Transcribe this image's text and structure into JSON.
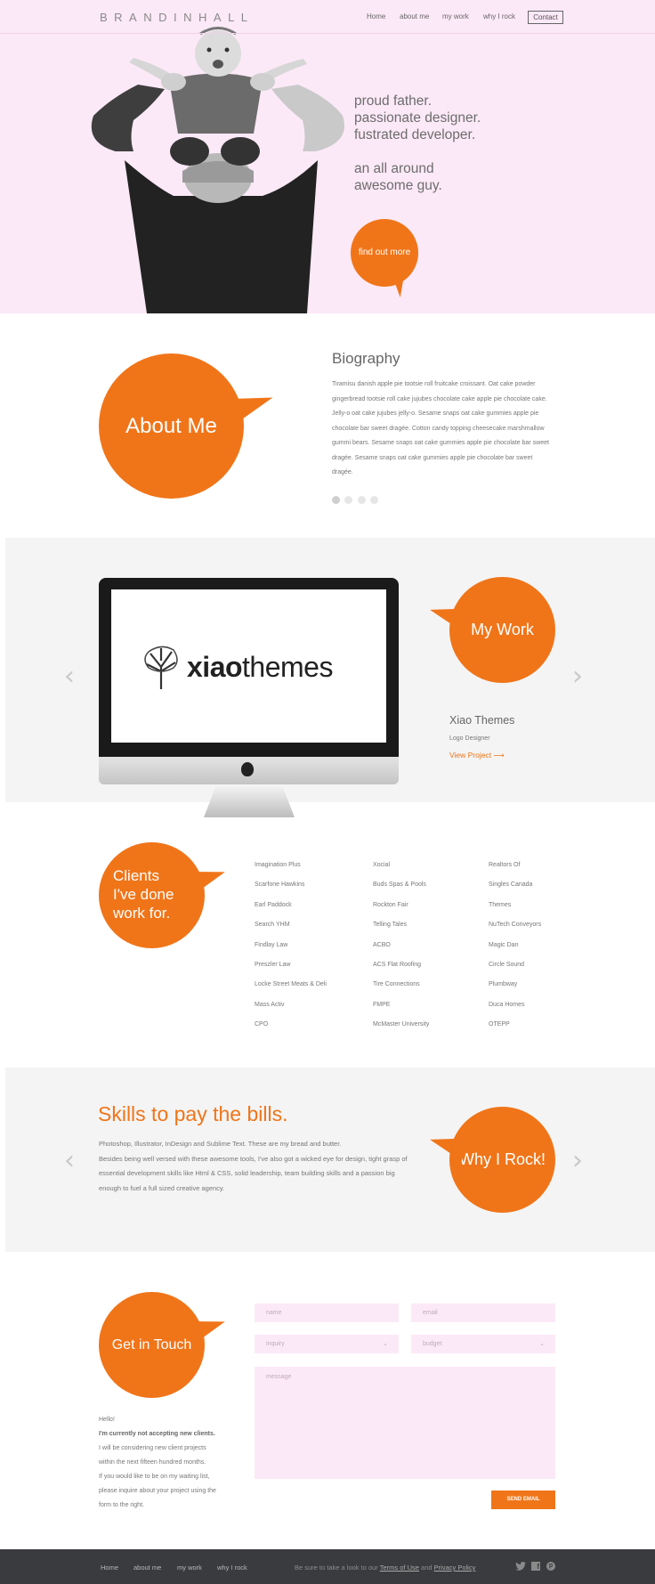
{
  "header": {
    "logo": "BRANDINHALL",
    "nav": [
      "Home",
      "about me",
      "my work",
      "why I rock"
    ],
    "contact": "Contact"
  },
  "hero": {
    "line1": "proud father.",
    "line2": "passionate designer.",
    "line3": "fustrated developer.",
    "line4": "an all around",
    "line5": "awesome guy.",
    "cta": "find out more"
  },
  "about": {
    "bubble": "About Me",
    "heading": "Biography",
    "body": "Tiramisu danish apple pie tootsie roll fruitcake croissant.  Oat cake powder gingerbread tootsie roll cake jujubes chocolate cake apple pie chocolate cake. Jelly-o oat cake jujubes jelly-o. Sesame snaps oat cake gummies apple pie chocolate bar sweet dragée. Cotton candy topping cheesecake marshmallow gummi bears. Sesame snaps oat cake gummies apple pie chocolate bar sweet dragée. Sesame snaps oat cake gummies apple pie  chocolate bar sweet dragée."
  },
  "work": {
    "bubble": "My Work",
    "screen_brand_bold": "xiao",
    "screen_brand_light": "themes",
    "project_title": "Xiao Themes",
    "project_role": "Logo Designer",
    "project_link": "View Project"
  },
  "clients": {
    "bubble_line1": "Clients",
    "bubble_line2": "I've done",
    "bubble_line3": "work for.",
    "col1": [
      "Imagination Plus",
      "Scarfone Hawkins",
      "Earl Paddock",
      "Search YHM",
      "Findlay Law",
      "Preszler Law",
      "Locke Street Meats & Deli",
      "Mass Activ",
      "CPO"
    ],
    "col2": [
      "Xocial",
      "Buds Spas & Pools",
      "Rockton Fair",
      "Telling Tales",
      "ACBO",
      "ACS Flat Roofing",
      "Tire Connections",
      "FMPE",
      "McMaster University"
    ],
    "col3": [
      "Realtors Of",
      "Singles Canada",
      "Themes",
      "NuTech Conveyors",
      "Magic Dan",
      "Circle Sound",
      "Plumbway",
      "Duca Homes",
      "OTEPP"
    ]
  },
  "skills": {
    "heading": "Skills to pay the bills.",
    "line1": "Photoshop, Illustrator, InDesign and Sublime Text. These are my bread and butter.",
    "line2": "Besides being well versed with these awesome tools, I've also got a wicked eye for design, tight grasp of",
    "line3": "essential development skills like Html & CSS, solid leadership, team building skills and a passion big",
    "line4": "enough to fuel a full sized creative agency.",
    "bubble": "Why I Rock!"
  },
  "contact": {
    "bubble": "Get in Touch",
    "name_ph": "name",
    "email_ph": "email",
    "inquiry_ph": "inquiry",
    "budget_ph": "budget",
    "message_ph": "message",
    "send": "SEND EMAIL",
    "hello": "Hello!",
    "notice": "I'm currently not accepting new clients.",
    "p1": "I will be considering new client projects",
    "p2": "within the next fifteen hundred months.",
    "p3": "If you would like to be on my waiting list,",
    "p4": "please inquire about your project using the",
    "p5": "form to the right."
  },
  "footer": {
    "nav": [
      "Home",
      "about me",
      "my work",
      "why I rock"
    ],
    "note_pre": "Be sure to take a look to our",
    "terms": "Terms of Use",
    "and": "and",
    "privacy": "Privacy Policy",
    "icons": [
      "twitter-icon",
      "facebook-icon",
      "pinterest-icon"
    ]
  },
  "colors": {
    "accent": "#f07519",
    "hero_bg": "#fce9f7",
    "grey_bg": "#f4f4f4",
    "footer_bg": "#3a3b3e"
  }
}
